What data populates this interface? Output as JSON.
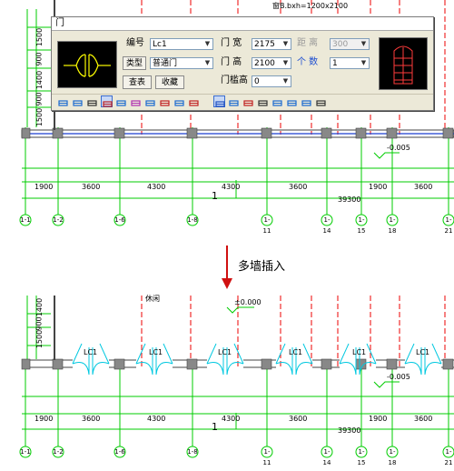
{
  "dialog": {
    "title": "门",
    "number_label": "编号",
    "number_value": "Lc1",
    "type_label": "类型",
    "type_value": "普通门",
    "lookup_button": "查表",
    "favorites_button": "收藏",
    "width_label": "门 宽",
    "width_value": "2175",
    "height_label": "门 高",
    "height_value": "2100",
    "sill_label": "门槛高",
    "sill_value": "0",
    "distance_label": "距 离",
    "distance_value": "300",
    "count_label": "个 数",
    "count_value": "1",
    "toolbar_icons": [
      "free-insert-icon",
      "along-wall-insert-icon",
      "axis-equal-insert-icon",
      "center-insert-icon",
      "axis-insert-icon",
      "wall-equal-insert-icon",
      "corner-insert-icon",
      "replace-icon",
      "window-icon",
      "door-icon",
      "pickup-icon",
      "eyedropper-icon",
      "mirror-icon",
      "bay-window-icon",
      "arc-window-icon",
      "hole-icon",
      "door-type-icon",
      "combo-icon"
    ]
  },
  "drawing_top": {
    "header_text": "窗B.bxh=1200x2100",
    "left_dims": [
      "1500",
      "900",
      "1400",
      "900",
      "1500"
    ],
    "elevation": "-0.005",
    "bottom_dims": [
      "1900",
      "3600",
      "4300",
      "4300",
      "3600",
      "1900",
      "3600"
    ],
    "total_dim": "39300",
    "section_mark": "1",
    "axes": [
      "1-1",
      "1-2",
      "1-6",
      "1-8",
      "1-11",
      "1-14",
      "1-15",
      "1-18",
      "1-21"
    ]
  },
  "caption": "多墙插入",
  "drawing_bottom": {
    "left_dims": [
      "1400",
      "900",
      "1500"
    ],
    "room_label": "休闲",
    "elevation_top": "±0.000",
    "elevation_bottom": "-0.005",
    "door_label": "LC1",
    "door_count": 6,
    "bottom_dims": [
      "1900",
      "3600",
      "4300",
      "4300",
      "3600",
      "1900",
      "3600"
    ],
    "total_dim": "39300",
    "section_mark": "1",
    "axes": [
      "1-1",
      "1-2",
      "1-6",
      "1-8",
      "1-11",
      "1-14",
      "1-15",
      "1-18",
      "1-21"
    ]
  },
  "colors": {
    "axis": "#00cc00",
    "wall": "#555555",
    "door": "#00c8e0",
    "red_axis": "#ee0000"
  }
}
